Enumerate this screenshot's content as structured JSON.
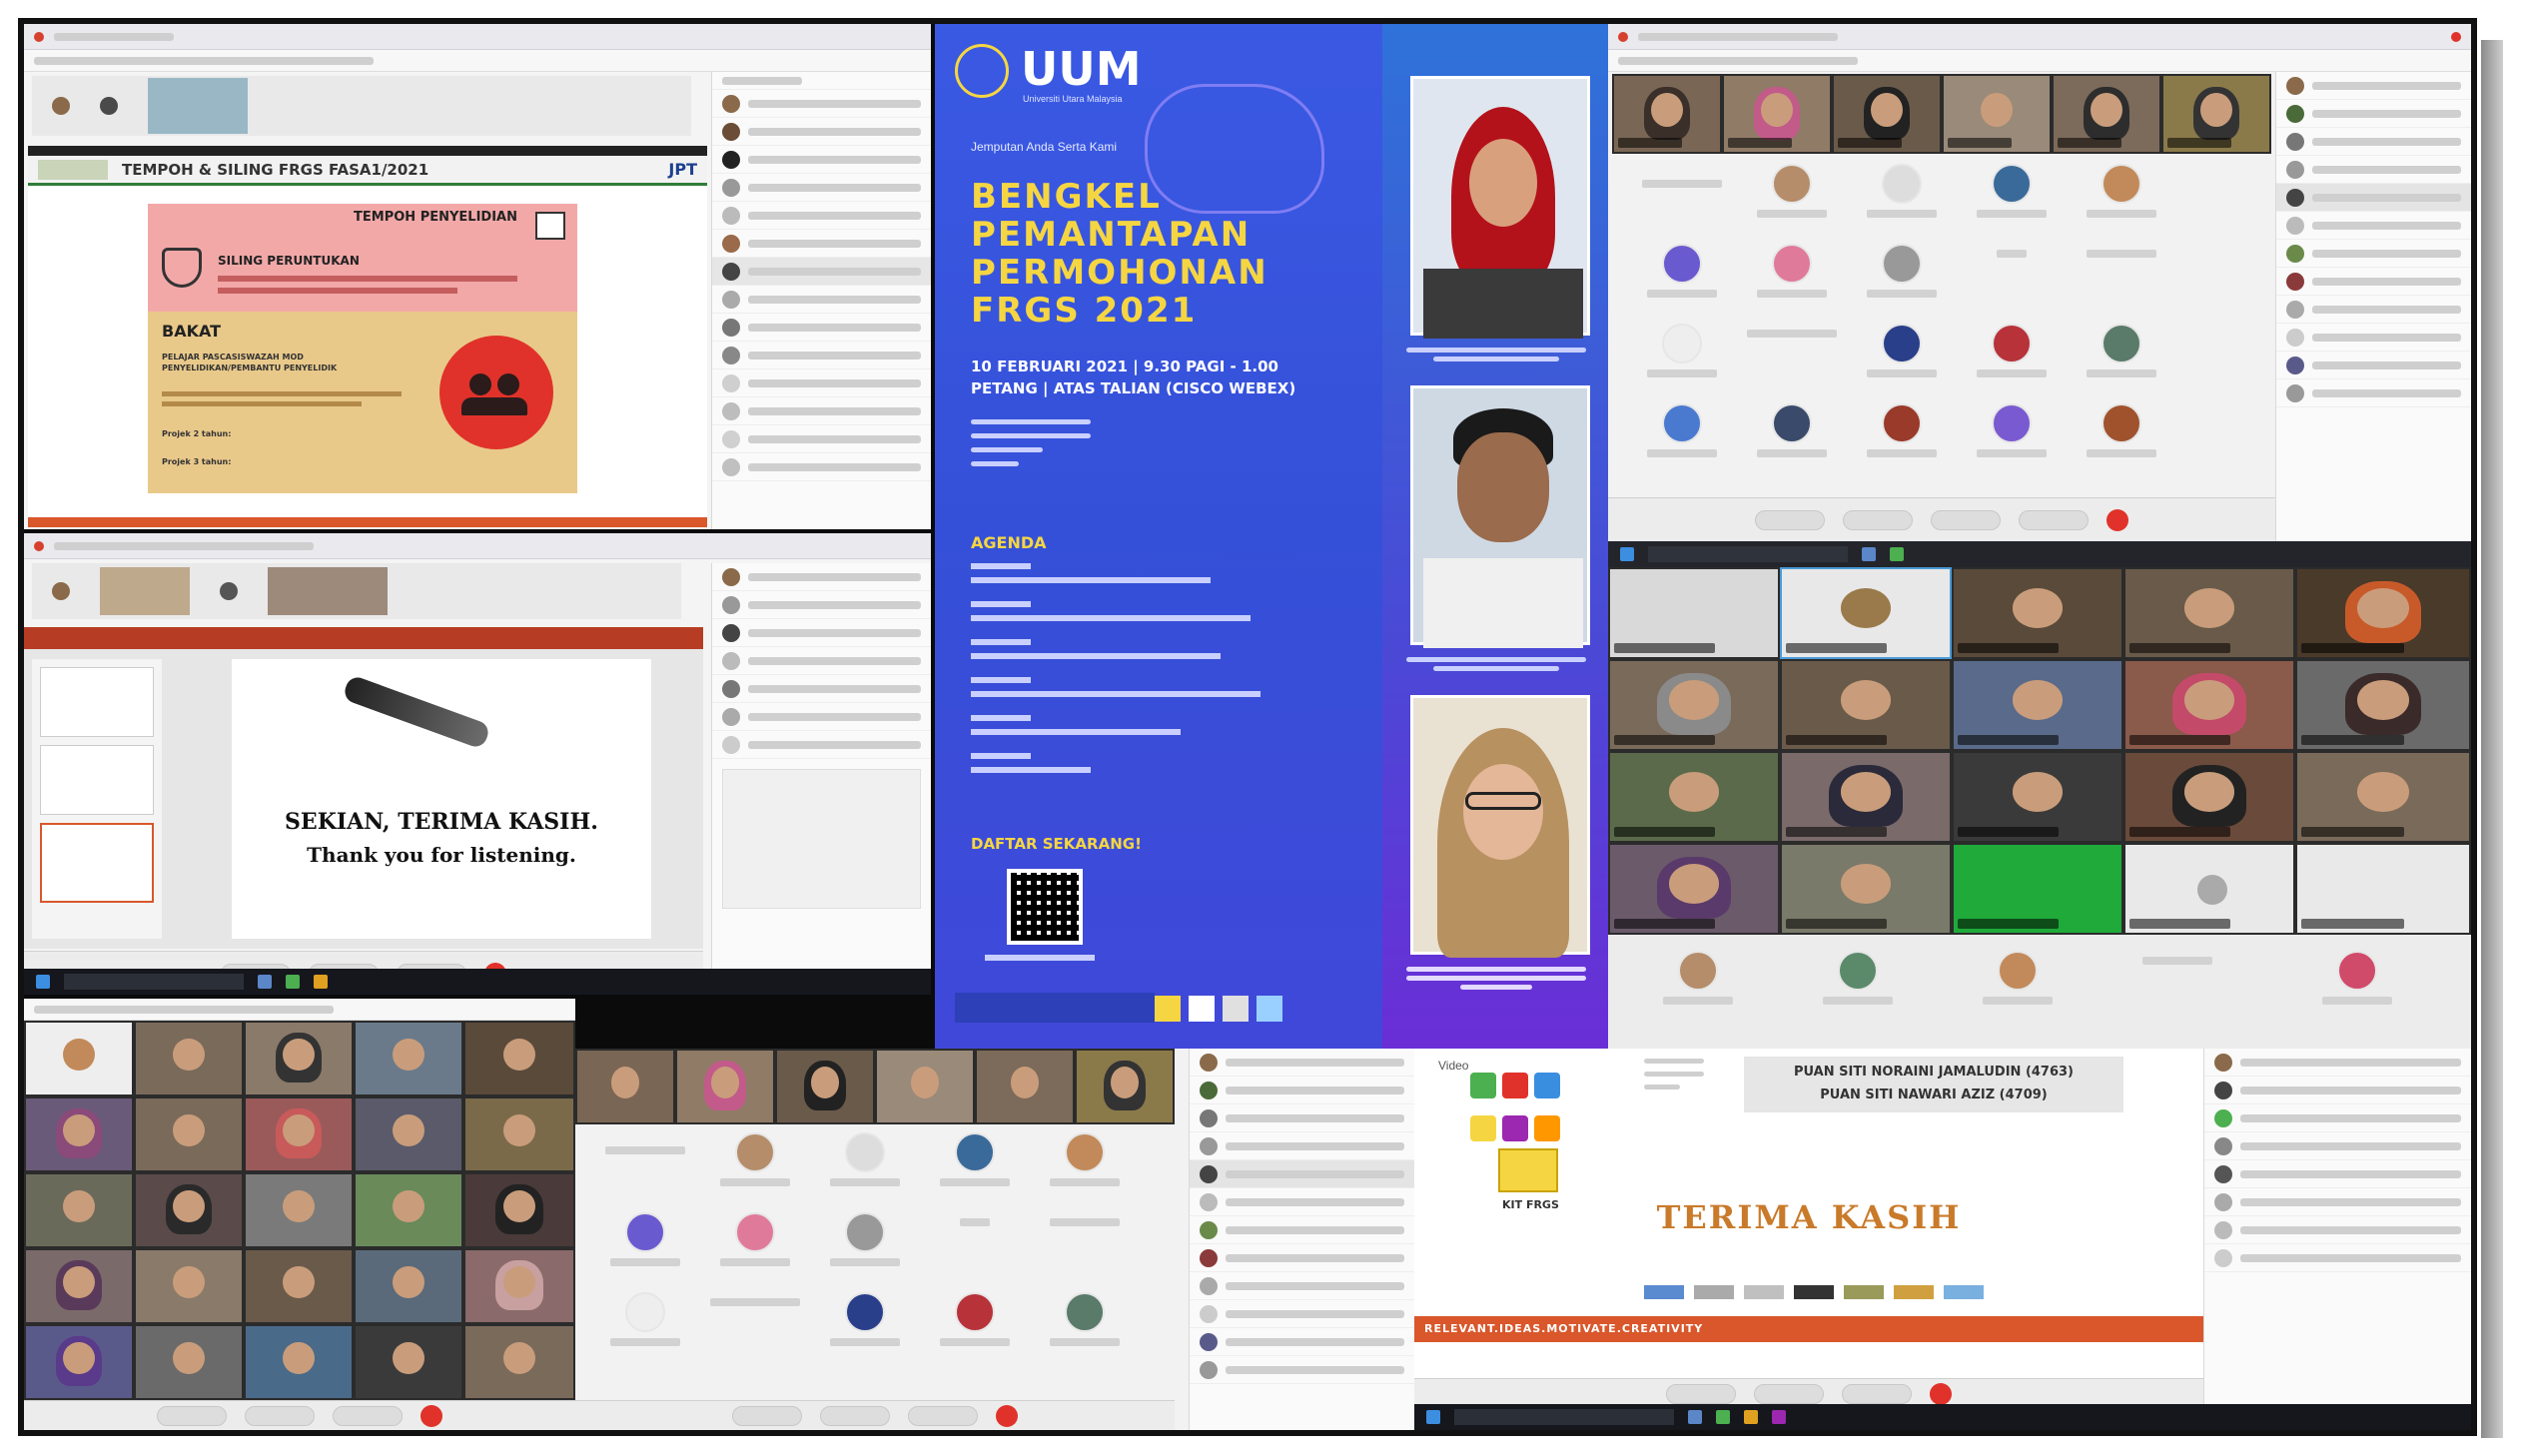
{
  "collage_title": "Bengkel Pemantapan Permohonan FRGS 2021 - Webex session screenshots",
  "slide_frgs": {
    "header": "TEMPOH & SILING FRGS FASA1/2021",
    "jpt_logo": "JPT",
    "tempoh_heading": "TEMPOH PENYELIDIAN",
    "siling_heading": "SILING PERUNTUKAN",
    "bakat_heading": "BAKAT",
    "bakat_subtitle": "PELAJAR PASCASISWAZAH MOD PENYELIDIKAN/PEMBANTU PENYELIDIK",
    "projek_label_1": "Projek 2 tahun:",
    "projek_label_2": "Projek 3 tahun:"
  },
  "slide_thanks": {
    "line1": "SEKIAN, TERIMA KASIH.",
    "line2": "Thank you for listening."
  },
  "poster": {
    "logo_text": "UUM",
    "logo_sub": "Universiti Utara Malaysia",
    "presenter_line": "Jemputan Anda Serta Kami",
    "title_line1": "BENGKEL",
    "title_line2": "PEMANTAPAN",
    "title_line3": "PERMOHONAN",
    "title_line4": "FRGS 2021",
    "date_line1": "10 FEBRUARI 2021 | 9.30 PAGI - 1.00",
    "date_line2": "PETANG | ATAS TALIAN (CISCO WEBEX)",
    "agenda_heading": "AGENDA",
    "register_heading": "DAFTAR SEKARANG!"
  },
  "farewell_slide": {
    "name_1": "PUAN SITI NORAINI JAMALUDIN (4763)",
    "name_2": "PUAN SITI NAWARI AZIZ (4709)",
    "thanks": "TERIMA KASIH",
    "kit_label": "KIT FRGS",
    "video_label": "Video",
    "footer_banner": "RELEVANT.IDEAS.MOTIVATE.CREATIVITY"
  },
  "colors": {
    "poster_blue": "#3a59e3",
    "poster_purple": "#6a2ed6",
    "poster_yellow": "#f5d642",
    "end_call_red": "#e0322a",
    "frgs_pink": "#f3a8a8",
    "frgs_tan": "#e9c98a"
  },
  "icons": {
    "people": "group-icon",
    "hand": "hand-money-icon",
    "check": "checkbox-icon",
    "qr": "qr-code-icon",
    "pen": "pen-icon",
    "brain": "brain-icon"
  }
}
